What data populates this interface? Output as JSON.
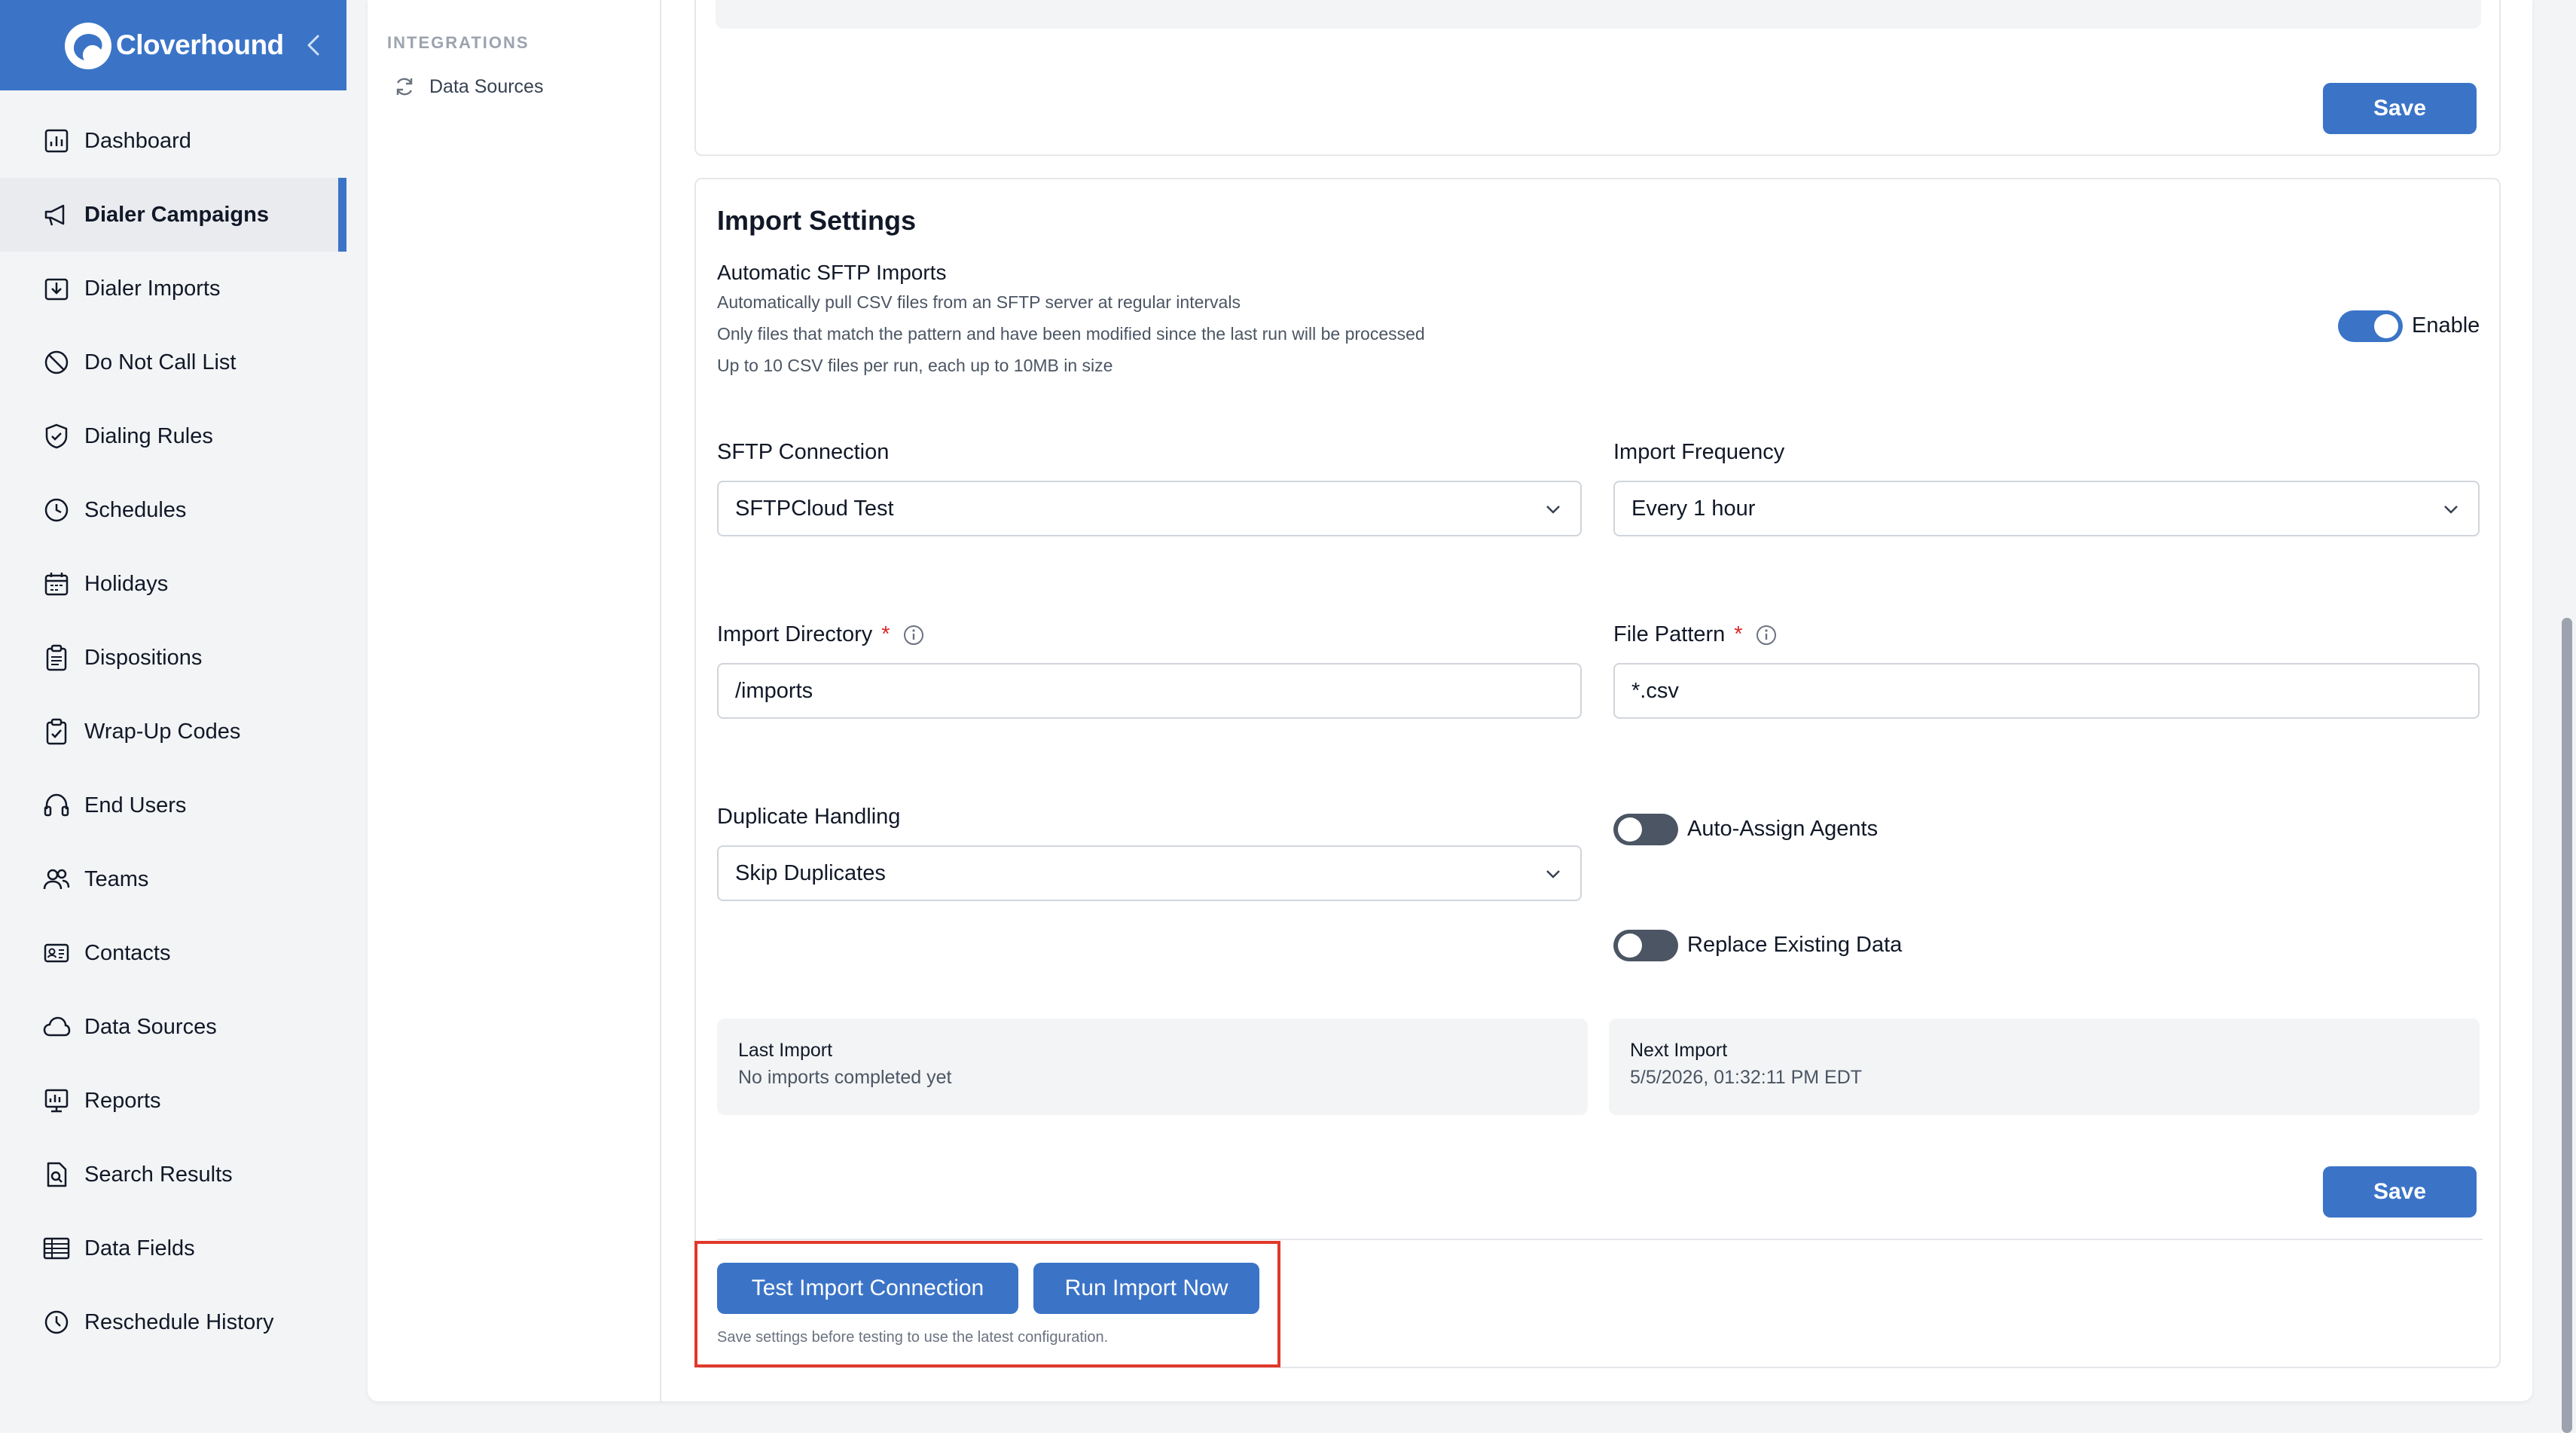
{
  "app": {
    "name": "Cloverhound"
  },
  "colors": {
    "accent": "#3b74c7",
    "highlight": "#e0392b",
    "sidebar_bg": "#f3f4f6"
  },
  "sidebar": {
    "items": [
      {
        "label": "Dashboard",
        "icon": "chart-icon"
      },
      {
        "label": "Dialer Campaigns",
        "icon": "megaphone-icon",
        "active": true
      },
      {
        "label": "Dialer Imports",
        "icon": "import-icon"
      },
      {
        "label": "Do Not Call List",
        "icon": "block-icon"
      },
      {
        "label": "Dialing Rules",
        "icon": "shield-icon"
      },
      {
        "label": "Schedules",
        "icon": "clock-icon"
      },
      {
        "label": "Holidays",
        "icon": "calendar-icon"
      },
      {
        "label": "Dispositions",
        "icon": "clipboard-icon"
      },
      {
        "label": "Wrap-Up Codes",
        "icon": "clipboard-check-icon"
      },
      {
        "label": "End Users",
        "icon": "headset-icon"
      },
      {
        "label": "Teams",
        "icon": "users-icon"
      },
      {
        "label": "Contacts",
        "icon": "id-card-icon"
      },
      {
        "label": "Data Sources",
        "icon": "cloud-icon"
      },
      {
        "label": "Reports",
        "icon": "report-icon"
      },
      {
        "label": "Search Results",
        "icon": "file-search-icon"
      },
      {
        "label": "Data Fields",
        "icon": "table-icon"
      },
      {
        "label": "Reschedule History",
        "icon": "history-icon"
      }
    ]
  },
  "subnav": {
    "section": "INTEGRATIONS",
    "item": {
      "label": "Data Sources",
      "icon": "sync-icon"
    }
  },
  "top_panel": {
    "save_label": "Save"
  },
  "import_settings": {
    "title": "Import Settings",
    "auto_title": "Automatic SFTP Imports",
    "descriptions": [
      "Automatically pull CSV files from an SFTP server at regular intervals",
      "Only files that match the pattern and have been modified since the last run will be processed",
      "Up to 10 CSV files per run, each up to 10MB in size"
    ],
    "enable": {
      "label": "Enable",
      "on": true
    },
    "sftp_connection": {
      "label": "SFTP Connection",
      "value": "SFTPCloud Test"
    },
    "import_frequency": {
      "label": "Import Frequency",
      "value": "Every 1 hour"
    },
    "import_directory": {
      "label": "Import Directory",
      "required": "*",
      "value": "/imports"
    },
    "file_pattern": {
      "label": "File Pattern",
      "required": "*",
      "value": "*.csv"
    },
    "duplicate_handling": {
      "label": "Duplicate Handling",
      "value": "Skip Duplicates"
    },
    "auto_assign": {
      "label": "Auto-Assign Agents",
      "on": false
    },
    "replace_existing": {
      "label": "Replace Existing Data",
      "on": false
    },
    "last_import": {
      "label": "Last Import",
      "value": "No imports completed yet"
    },
    "next_import": {
      "label": "Next Import",
      "value": "5/5/2026, 01:32:11 PM EDT"
    },
    "save_label": "Save",
    "test_button": "Test Import Connection",
    "run_button": "Run Import Now",
    "helper": "Save settings before testing to use the latest configuration."
  }
}
